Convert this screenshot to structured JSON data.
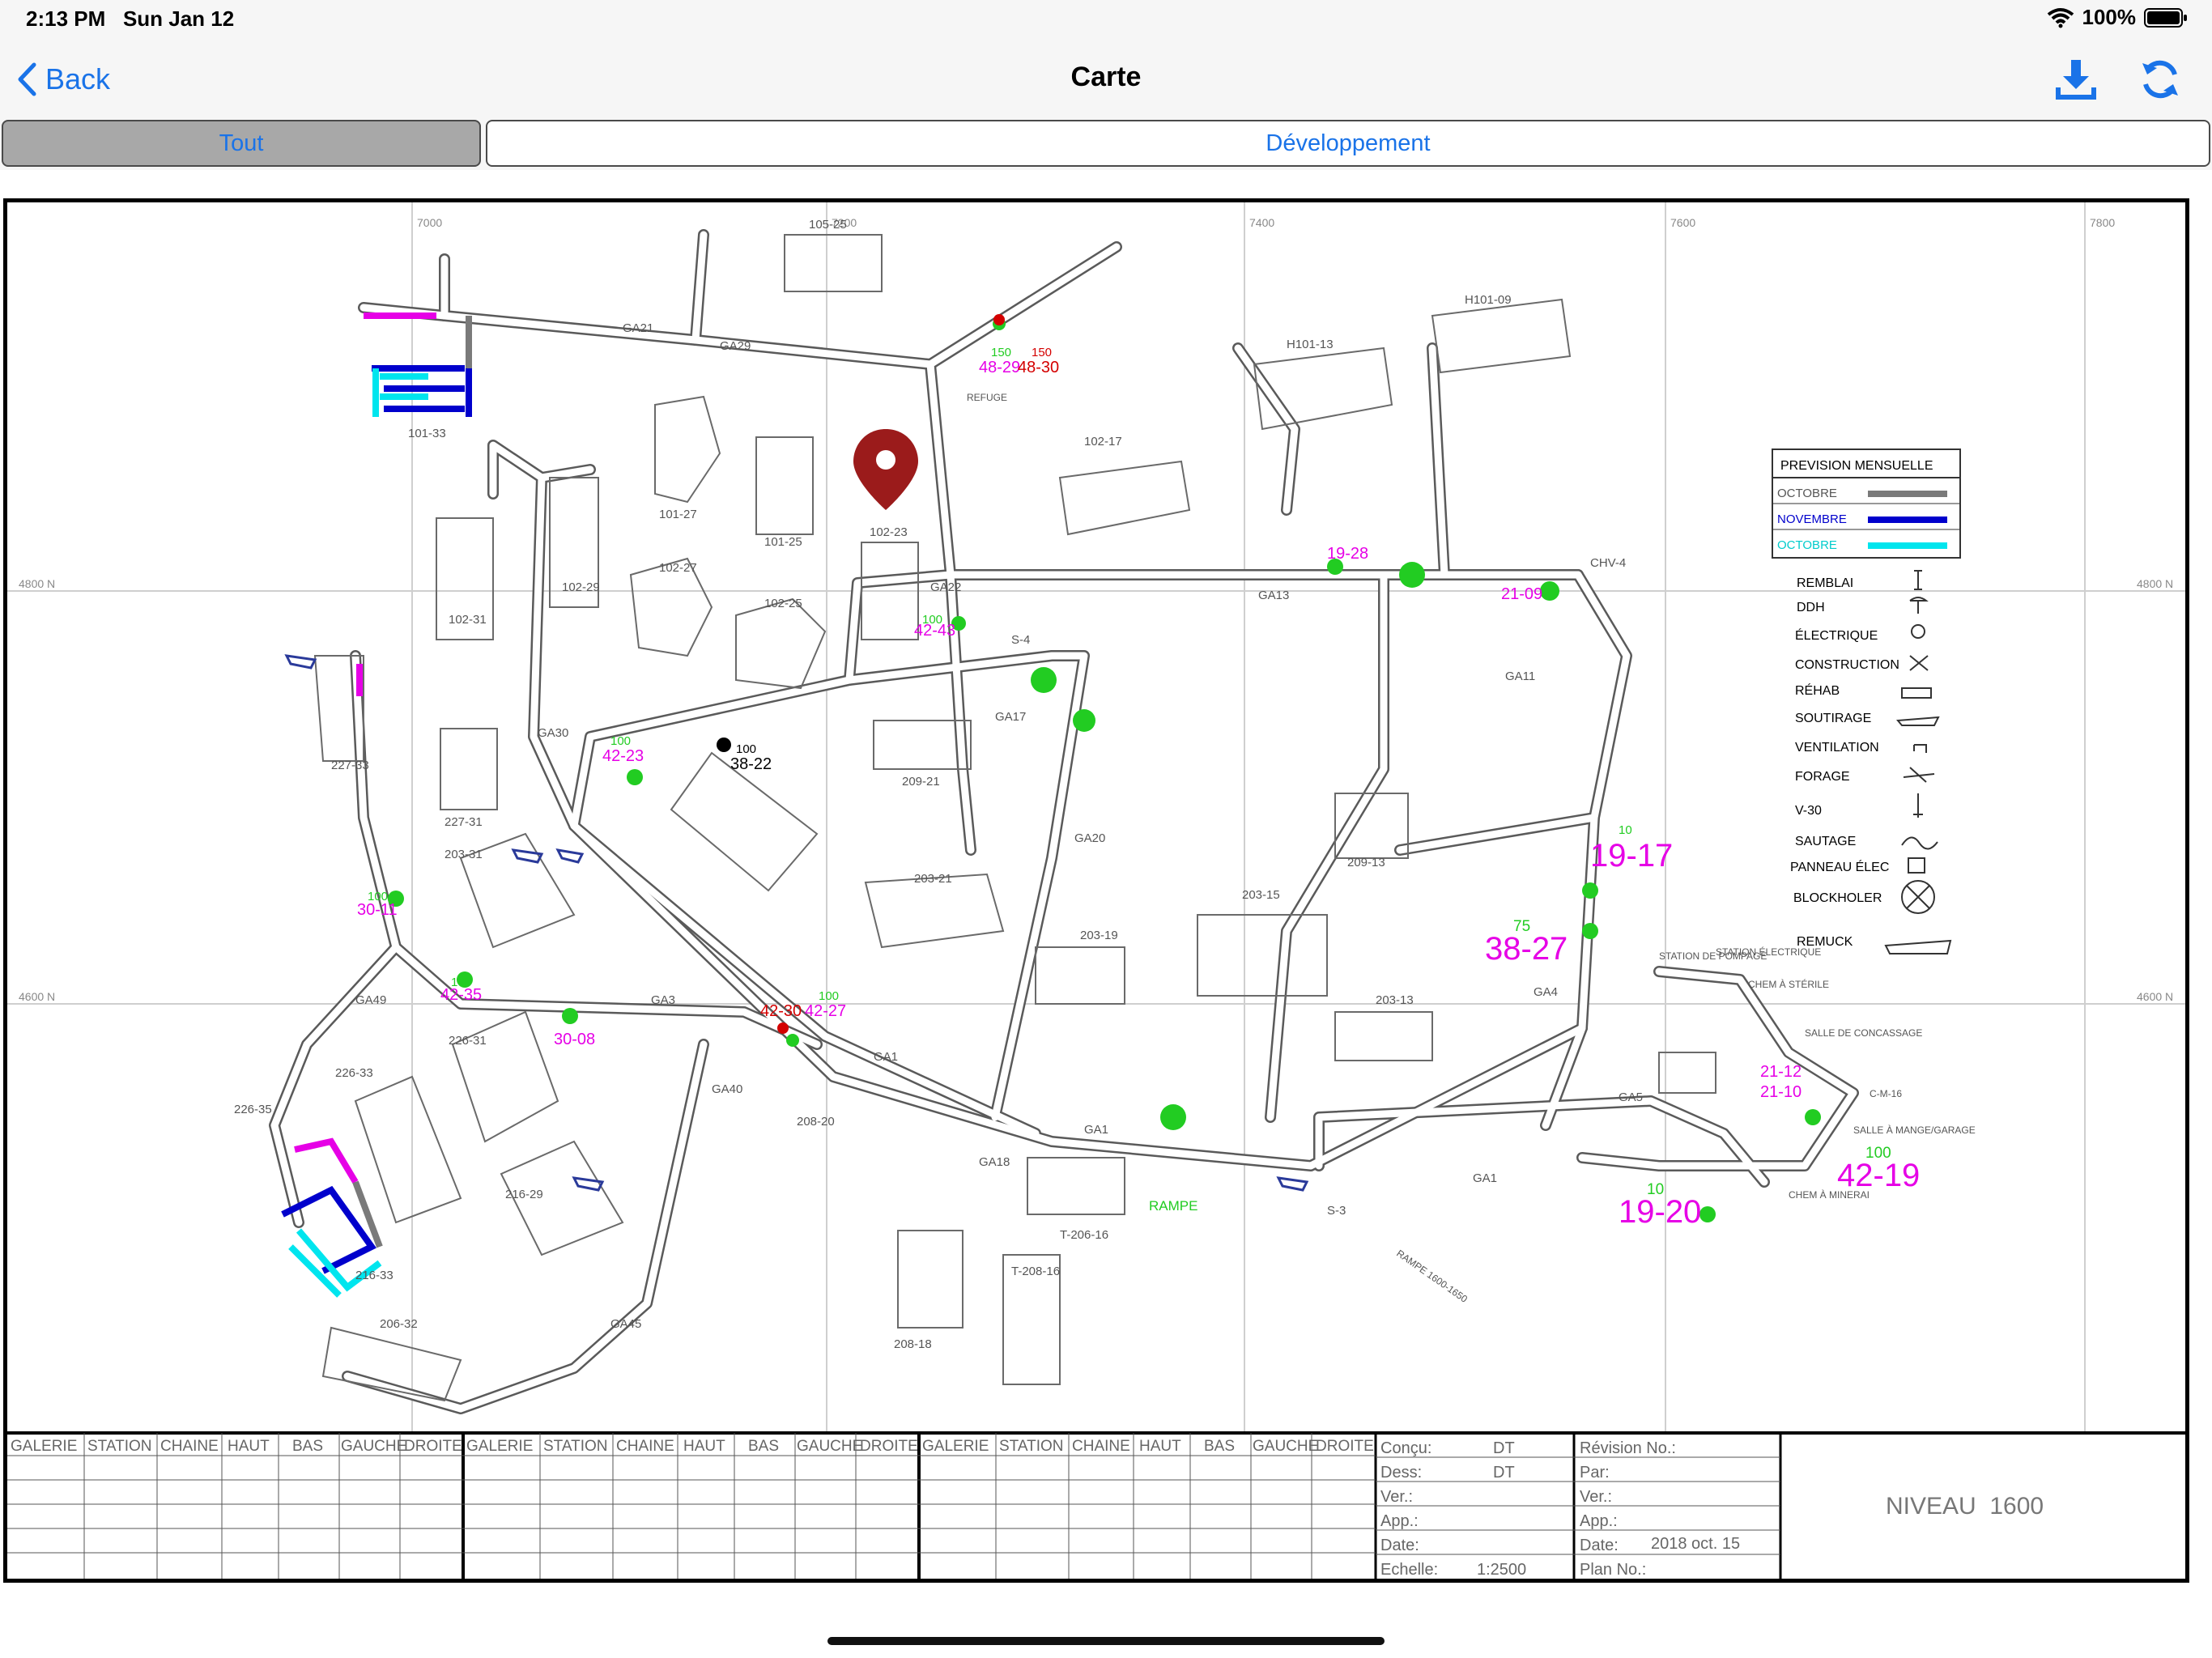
{
  "status_bar": {
    "time": "2:13 PM",
    "date": "Sun Jan 12",
    "battery": "100%"
  },
  "nav": {
    "back_label": "Back",
    "title": "Carte"
  },
  "tabs": [
    {
      "label": "Tout",
      "selected": true
    },
    {
      "label": "Développement",
      "selected": false
    }
  ],
  "colors": {
    "accent": "#1a73e8",
    "magenta": "#e600e6",
    "green": "#22cc22",
    "red": "#d40000",
    "blue": "#0000cc",
    "cyan": "#00e5ee",
    "gray": "#808080",
    "pin": "#9b1b1b"
  },
  "plan": {
    "grid_labels_top": [
      "7000",
      "7200",
      "7400",
      "7600",
      "7800"
    ],
    "grid_labels_side": [
      "4800 N",
      "4600 N"
    ],
    "stope_numbers_large": [
      "19-17",
      "38-27",
      "42-19",
      "19-20"
    ],
    "stope_numbers": [
      "48-29",
      "48-30",
      "19-28",
      "21-09",
      "42-43",
      "42-23",
      "38-22",
      "30-11",
      "42-35",
      "30-08",
      "42-30",
      "42-27",
      "21-12",
      "21-10"
    ],
    "tonnages": [
      "150",
      "150",
      "100",
      "100",
      "100",
      "100",
      "100",
      "100",
      "75",
      "10",
      "10",
      "100"
    ],
    "areas": [
      "105-25",
      "101-33",
      "101-27",
      "101-25",
      "102-23",
      "102-27",
      "102-25",
      "102-29",
      "102-31",
      "102-17",
      "H101-13",
      "H101-09",
      "CHV-4",
      "227-33",
      "227-31",
      "203-31",
      "209-21",
      "209-13",
      "203-21",
      "203-15",
      "203-19",
      "203-13",
      "226-35",
      "226-33",
      "226-31",
      "216-33",
      "206-32",
      "216-29",
      "208-20",
      "208-18",
      "T-206-16",
      "T-208-16",
      "S-3",
      "S-4",
      "RAMPE"
    ],
    "galleries": [
      "GA21",
      "GA29",
      "GA22",
      "GA13",
      "GA11",
      "GA17",
      "GA30",
      "GA20",
      "GA3",
      "GA49",
      "GA1",
      "GA40",
      "GA45",
      "GA4",
      "GA5",
      "GA18"
    ],
    "annotations": [
      "REFUGE",
      "RAMPE 1600-1650",
      "SALLE DE CONCASSAGE",
      "STATION ÉLECTRIQUE",
      "STATION DE POMPAGE",
      "CHEM À STÉRILE",
      "CHEM À MINERAI",
      "SALLE À MANGE/GARAGE",
      "C-M-16"
    ]
  },
  "legend": {
    "title": "PREVISION MENSUELLE",
    "months": [
      {
        "label": "OCTOBRE",
        "color": "#7a7a7a",
        "text_color": "#555555"
      },
      {
        "label": "NOVEMBRE",
        "color": "#0000cc",
        "text_color": "#0000cc"
      },
      {
        "label": "OCTOBRE",
        "color": "#00e5ee",
        "text_color": "#00cccc"
      }
    ],
    "symbols": [
      "REMBLAI",
      "DDH",
      "ÉLECTRIQUE",
      "CONSTRUCTION",
      "RÉHAB",
      "SOUTIRAGE",
      "VENTILATION",
      "FORAGE",
      "V-30",
      "SAUTAGE",
      "PANNEAU ÉLEC",
      "BLOCKHOLER",
      "REMUCK"
    ]
  },
  "title_block": {
    "columns": [
      "GALERIE",
      "STATION",
      "CHAINE",
      "HAUT",
      "BAS",
      "GAUCHE",
      "DROITE"
    ],
    "fields_left": [
      {
        "label": "Conçu:",
        "value": "DT"
      },
      {
        "label": "Dess:",
        "value": "DT"
      },
      {
        "label": "Ver.:",
        "value": ""
      },
      {
        "label": "App.:",
        "value": ""
      },
      {
        "label": "Date:",
        "value": ""
      },
      {
        "label": "Echelle:",
        "value": "1:2500"
      }
    ],
    "fields_right": [
      {
        "label": "Révision No.:",
        "value": ""
      },
      {
        "label": "Par:",
        "value": ""
      },
      {
        "label": "Ver.:",
        "value": ""
      },
      {
        "label": "App.:",
        "value": ""
      },
      {
        "label": "Date:",
        "value": "2018 oct. 15"
      },
      {
        "label": "Plan No.:",
        "value": ""
      }
    ],
    "level": "NIVEAU  1600"
  }
}
